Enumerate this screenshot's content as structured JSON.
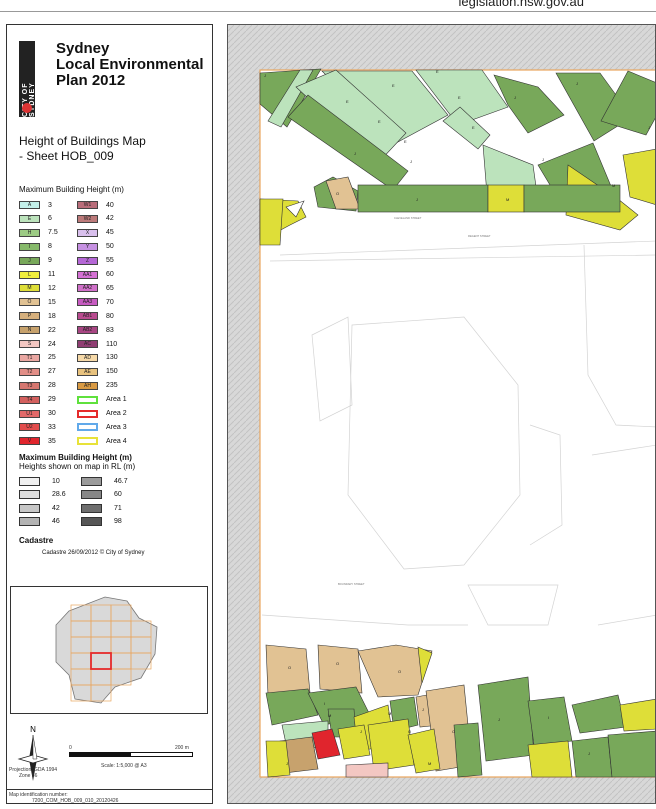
{
  "browser": {
    "url_text": "legislation.nsw.gov.au"
  },
  "header": {
    "logo_text": "CITY OF SYDNEY",
    "plan_title": [
      "Sydney",
      "Local Environmental",
      "Plan 2012"
    ],
    "map_title": [
      "Height of Buildings Map",
      "- Sheet HOB_009"
    ]
  },
  "legend": {
    "section_max": "Maximum Building Height (m)",
    "heights": [
      {
        "code": "A",
        "value": "3",
        "color": "#c4f0ea",
        "col": 0
      },
      {
        "code": "E",
        "value": "6",
        "color": "#bce3bc",
        "col": 0
      },
      {
        "code": "H",
        "value": "7.5",
        "color": "#9ccb84",
        "col": 0
      },
      {
        "code": "I",
        "value": "8",
        "color": "#86b96a",
        "col": 0
      },
      {
        "code": "J",
        "value": "9",
        "color": "#78a85a",
        "col": 0
      },
      {
        "code": "L",
        "value": "11",
        "color": "#f1ee3c",
        "col": 0
      },
      {
        "code": "M",
        "value": "12",
        "color": "#dede38",
        "col": 0
      },
      {
        "code": "O",
        "value": "15",
        "color": "#e1c293",
        "col": 0
      },
      {
        "code": "P",
        "value": "18",
        "color": "#d6b07d",
        "col": 0
      },
      {
        "code": "N",
        "value": "22",
        "color": "#c7a26d",
        "col": 0
      },
      {
        "code": "S",
        "value": "24",
        "color": "#f3c7c2",
        "col": 0
      },
      {
        "code": "T1",
        "value": "25",
        "color": "#eaa7a2",
        "col": 0
      },
      {
        "code": "T2",
        "value": "27",
        "color": "#e28e87",
        "col": 0
      },
      {
        "code": "T3",
        "value": "28",
        "color": "#d67770",
        "col": 0
      },
      {
        "code": "T4",
        "value": "29",
        "color": "#d3605e",
        "col": 0
      },
      {
        "code": "U1",
        "value": "30",
        "color": "#e36a6a",
        "col": 0
      },
      {
        "code": "U2",
        "value": "33",
        "color": "#e24c4c",
        "col": 0
      },
      {
        "code": "V",
        "value": "35",
        "color": "#e0252d",
        "col": 0
      },
      {
        "code": "W1",
        "value": "40",
        "color": "#b96d7a",
        "col": 1
      },
      {
        "code": "W2",
        "value": "42",
        "color": "#bc7a7a",
        "col": 1
      },
      {
        "code": "X",
        "value": "45",
        "color": "#d9c0ed",
        "col": 1
      },
      {
        "code": "Y",
        "value": "50",
        "color": "#c691e2",
        "col": 1
      },
      {
        "code": "Z",
        "value": "55",
        "color": "#b567d6",
        "col": 1
      },
      {
        "code": "AA1",
        "value": "60",
        "color": "#d571d4",
        "col": 1
      },
      {
        "code": "AA2",
        "value": "65",
        "color": "#d070c9",
        "col": 1
      },
      {
        "code": "AA3",
        "value": "70",
        "color": "#c75bc1",
        "col": 1
      },
      {
        "code": "AB1",
        "value": "80",
        "color": "#b94b8f",
        "col": 1
      },
      {
        "code": "AB2",
        "value": "83",
        "color": "#a84683",
        "col": 1
      },
      {
        "code": "AC",
        "value": "110",
        "color": "#8f3d72",
        "col": 1
      },
      {
        "code": "AD",
        "value": "130",
        "color": "#f6d9a8",
        "col": 1
      },
      {
        "code": "AE",
        "value": "150",
        "color": "#e8c27e",
        "col": 1
      },
      {
        "code": "AH",
        "value": "235",
        "color": "#d99a43",
        "col": 1
      },
      {
        "code": "",
        "value": "Area 1",
        "color": "#5fe13c",
        "col": 1,
        "area": true
      },
      {
        "code": "",
        "value": "Area 2",
        "color": "#e52b2b",
        "col": 1,
        "area": true
      },
      {
        "code": "",
        "value": "Area 3",
        "color": "#61a9ea",
        "col": 1,
        "area": true
      },
      {
        "code": "",
        "value": "Area 4",
        "color": "#e8e239",
        "col": 1,
        "area": true
      }
    ],
    "section_rl": "Maximum Building Height (m)",
    "rl_subtitle": "Heights shown on map in RL (m)",
    "rl_values": [
      {
        "value": "10",
        "color": "#f0f0f0"
      },
      {
        "value": "28.6",
        "color": "#dedede"
      },
      {
        "value": "42",
        "color": "#c7c7c7"
      },
      {
        "value": "46",
        "color": "#b3b3b3"
      },
      {
        "value": "46.7",
        "color": "#9b9b9b"
      },
      {
        "value": "60",
        "color": "#878787"
      },
      {
        "value": "71",
        "color": "#6e6e6e"
      },
      {
        "value": "98",
        "color": "#565656"
      }
    ],
    "cadastre_heading": "Cadastre",
    "cadastre_text": "Cadastre 26/09/2012 © City of Sydney"
  },
  "footer": {
    "north_label": "N",
    "scale_zero": "0",
    "scale_max": "200 m",
    "scale_text": "Scale: 1:5,000 @ A3",
    "projection": "Projection: GDA 1994",
    "zone": "Zone 56",
    "map_id_label": "Map identification number:",
    "map_id": "7200_COM_HOB_009_010_20120426"
  },
  "map": {
    "zone_labels": [
      "J",
      "E",
      "E",
      "E",
      "E",
      "E",
      "J",
      "E",
      "E",
      "J",
      "J",
      "J",
      "J",
      "M",
      "J",
      "O",
      "J",
      "M",
      "I",
      "J",
      "J",
      "M",
      "J",
      "M",
      "O",
      "O",
      "O",
      "O",
      "O",
      "J",
      "I",
      "M",
      "J"
    ],
    "street_names": [
      "CLEVELAND STREET",
      "REGENT STREET",
      "BOUNDARY STREET"
    ],
    "background_color": "#d8d8d8",
    "map_white": "#ffffff"
  }
}
